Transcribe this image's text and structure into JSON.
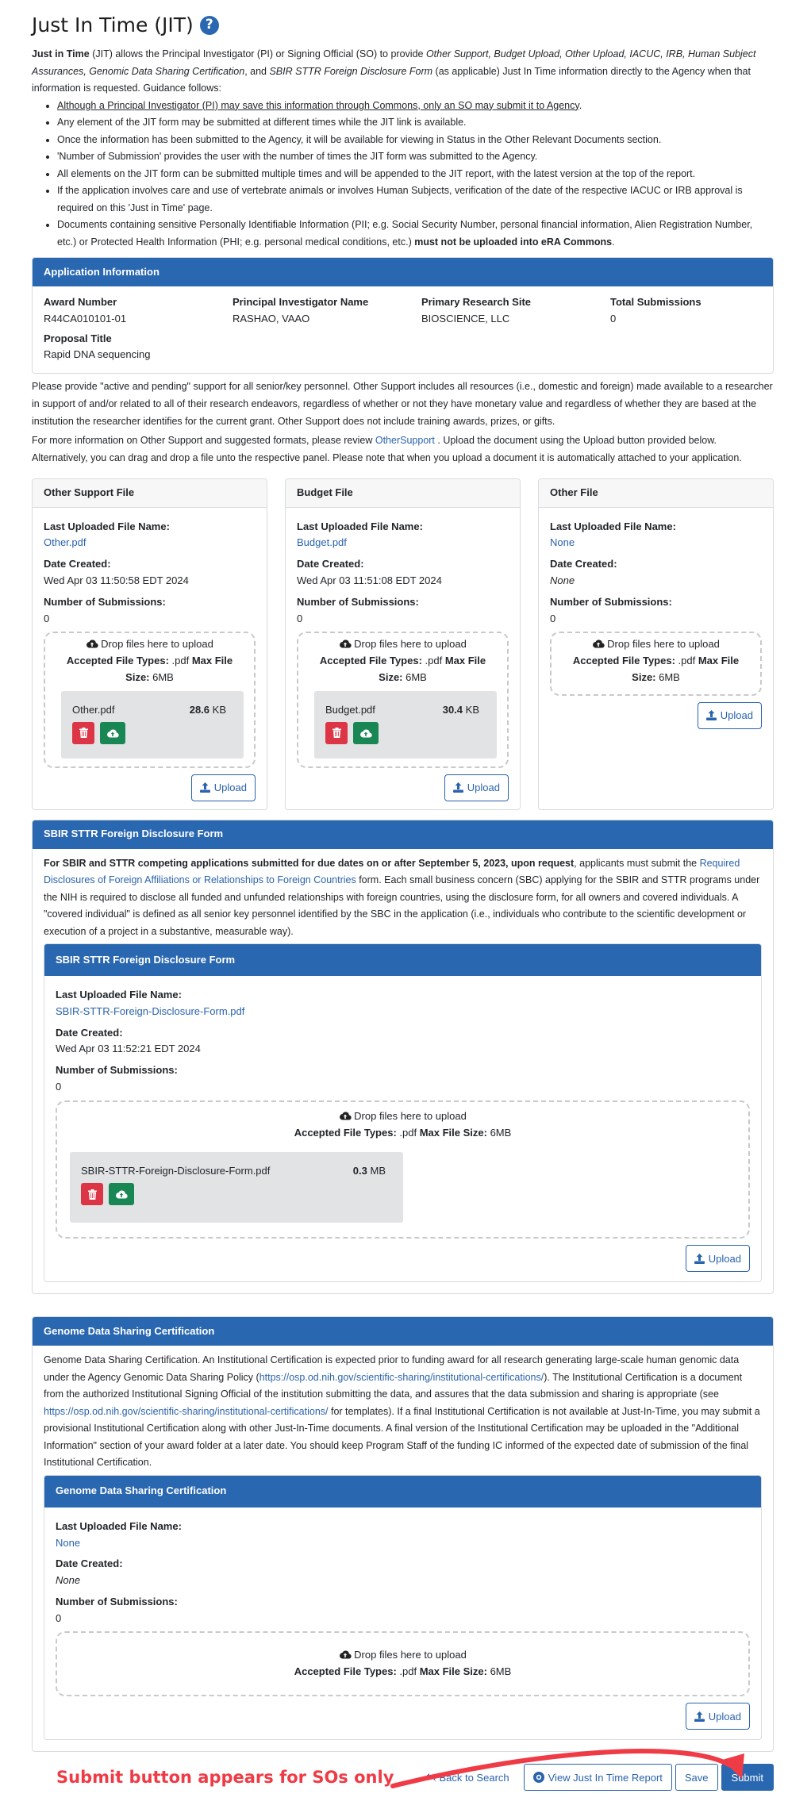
{
  "page": {
    "title": "Just In Time (JIT)",
    "help_icon": "question-circle-icon"
  },
  "intro": {
    "lead_bold": "Just in Time",
    "lead_1": " (JIT) allows the Principal Investigator (PI) or Signing Official (SO) to provide ",
    "lead_italic_1": "Other Support, Budget Upload, Other Upload, IACUC, IRB, Human Subject Assurances, Genomic Data Sharing Certification",
    "lead_2": ", and ",
    "lead_italic_2": "SBIR STTR Foreign Disclosure Form",
    "lead_3": " (as applicable) Just In Time information directly to the Agency when that information is requested.  Guidance follows:",
    "bullets": [
      "Although a Principal Investigator (PI) may save this information through Commons, only an SO may submit it to Agency",
      "Any element of the JIT form may be submitted at different times while the JIT link is available.",
      "Once the information has been submitted to the Agency, it will be available for viewing in Status in the Other Relevant Documents section.",
      "'Number of Submission' provides the user with the number of times the JIT form was submitted to the Agency.",
      "All elements on the JIT form can be submitted multiple times and will be appended to the JIT report, with the latest version at the top of the report.",
      "If the application involves care and use of vertebrate animals or involves Human Subjects, verification of the date of the respective IACUC or IRB approval is required on this 'Just in Time' page."
    ],
    "bullet_last_text": "Documents containing sensitive Personally Identifiable Information (PII; e.g. Social Security Number, personal financial information, Alien Registration Number, etc.) or Protected Health Information (PHI; e.g. personal medical conditions, etc.) ",
    "bullet_last_bold": "must not be uploaded into eRA Commons",
    "period": "."
  },
  "application_info": {
    "header": "Application Information",
    "award_number_label": "Award Number",
    "award_number": "R44CA010101-01",
    "pi_label": "Principal Investigator Name",
    "pi_name": "RASHAO, VAAO",
    "site_label": "Primary Research Site",
    "site": "BIOSCIENCE, LLC",
    "total_label": "Total Submissions",
    "total": "0",
    "proposal_label": "Proposal Title",
    "proposal_title": "Rapid DNA sequencing"
  },
  "other_support_text": {
    "p1": "Please provide \"active and pending\" support for all senior/key personnel. Other Support includes all resources (i.e., domestic and foreign) made available to a researcher in support of and/or related to all of their research endeavors, regardless of whether or not they have monetary value and regardless of whether they are based at the institution the researcher identifies for the current grant. Other Support does not include training awards, prizes, or gifts.",
    "p2_a": "For more information on Other Support and suggested formats, please review ",
    "p2_link": "OtherSupport",
    "p2_b": " . Upload the document using the Upload button provided below. Alternatively, you can drag and drop a file unto the respective panel. Please note that when you upload a document it is automatically attached to your application."
  },
  "labels": {
    "last_uploaded": "Last Uploaded File Name:",
    "date_created": "Date Created:",
    "num_submissions": "Number of Submissions:",
    "drop_files": "Drop files here to upload",
    "accepted_types_label": "Accepted File Types:",
    "accepted_types": " .pdf ",
    "max_size_label": "Max File Size:",
    "max_file_label": "Max File",
    "size_label": "Size:",
    "max_size": " 6MB",
    "upload": "Upload"
  },
  "file_cards": [
    {
      "title": "Other Support File",
      "file_name": "Other.pdf",
      "date_created": "Wed Apr 03 11:50:58 EDT 2024",
      "submissions": "0",
      "preview": {
        "name": "Other.pdf",
        "size_num": "28.6",
        "size_unit": " KB"
      }
    },
    {
      "title": "Budget File",
      "file_name": "Budget.pdf",
      "date_created": "Wed Apr 03 11:51:08 EDT 2024",
      "submissions": "0",
      "preview": {
        "name": "Budget.pdf",
        "size_num": "30.4",
        "size_unit": " KB"
      }
    },
    {
      "title": "Other File",
      "file_name": "None",
      "date_created": "None",
      "submissions": "0"
    }
  ],
  "sbir": {
    "header": "SBIR STTR Foreign Disclosure Form",
    "desc_bold": "For SBIR and STTR competing applications submitted for due dates on or after September 5, 2023, upon request",
    "desc_1": ", applicants must submit the ",
    "desc_link": "Required Disclosures of Foreign Affiliations or Relationships to Foreign Countries",
    "desc_2": " form. Each small business concern (SBC) applying for the SBIR and STTR programs under the NIH is required to disclose all funded and unfunded relationships with foreign countries, using the disclosure form, for all owners and covered individuals. A \"covered individual\" is defined as all senior key personnel identified by the SBC in the application (i.e., individuals who contribute to the scientific development or execution of a project in a substantive, measurable way).",
    "inner_header": "SBIR STTR Foreign Disclosure Form",
    "file_name": "SBIR-STTR-Foreign-Disclosure-Form.pdf",
    "date_created": "Wed Apr 03 11:52:21 EDT 2024",
    "submissions": "0",
    "preview": {
      "name": "SBIR-STTR-Foreign-Disclosure-Form.pdf",
      "size_num": "0.3",
      "size_unit": " MB"
    }
  },
  "gds": {
    "header": "Genome Data Sharing Certification",
    "desc_1": "Genome Data Sharing Certification. An Institutional Certification is expected prior to funding award for all research generating large-scale human genomic data under the Agency Genomic Data Sharing Policy (",
    "link_1": "https://osp.od.nih.gov/scientific-sharing/institutional-certifications/",
    "desc_2": "). The Institutional Certification is a document from the authorized Institutional Signing Official of the institution submitting the data, and assures that the data submission and sharing is appropriate (see ",
    "link_2": "https://osp.od.nih.gov/scientific-sharing/institutional-certifications/",
    "desc_3": " for templates). If a final Institutional Certification is not available at Just-In-Time, you may submit a provisional Institutional Certification along with other Just-In-Time documents. A final version of the Institutional Certification may be uploaded in the \"Additional Information\" section of your award folder at a later date. You should keep Program Staff of the funding IC informed of the expected date of submission of the final Institutional Certification.",
    "inner_header": "Genome Data Sharing Certification",
    "file_name": "None",
    "date_created": "None",
    "submissions": "0"
  },
  "footer": {
    "annotation": "Submit button appears for SOs only",
    "back": "Back to Search",
    "view_report": "View Just In Time Report",
    "save": "Save",
    "submit": "Submit"
  },
  "colors": {
    "primary": "#2a67b1",
    "link": "#2a63ad",
    "danger": "#dc3545",
    "success": "#198754",
    "annotation": "#ef3b46"
  }
}
